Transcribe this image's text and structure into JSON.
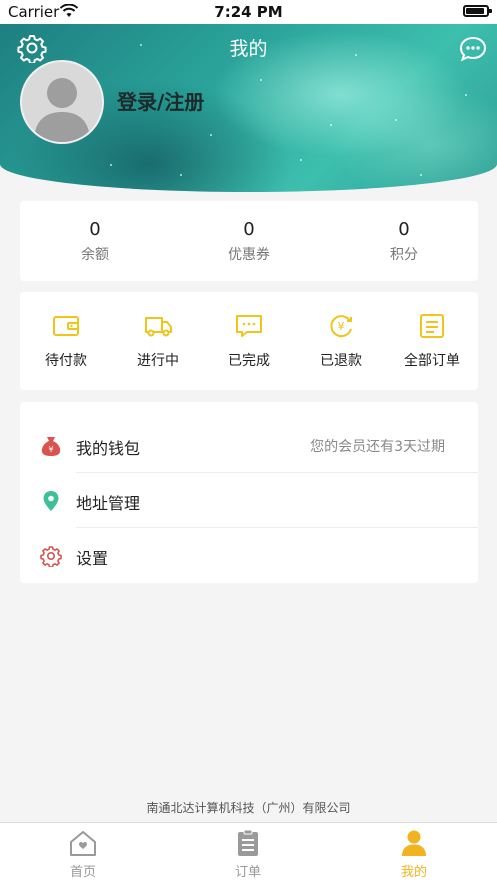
{
  "status_bar": {
    "carrier": "Carrier",
    "time": "7:24 PM"
  },
  "header": {
    "title": "我的",
    "login_label": "登录/注册"
  },
  "stats": [
    {
      "value": "0",
      "label": "余额"
    },
    {
      "value": "0",
      "label": "优惠券"
    },
    {
      "value": "0",
      "label": "积分"
    }
  ],
  "orders": [
    {
      "label": "待付款",
      "icon": "wallet-icon"
    },
    {
      "label": "进行中",
      "icon": "truck-icon"
    },
    {
      "label": "已完成",
      "icon": "chat-done-icon"
    },
    {
      "label": "已退款",
      "icon": "refund-icon"
    },
    {
      "label": "全部订单",
      "icon": "order-list-icon"
    }
  ],
  "menu": [
    {
      "label": "我的钱包",
      "note": "您的会员还有3天过期",
      "icon": "money-bag-icon"
    },
    {
      "label": "地址管理",
      "icon": "location-pin-icon"
    },
    {
      "label": "设置",
      "icon": "gear-icon"
    }
  ],
  "footer": {
    "company": "南通北达计算机科技（广州）有限公司"
  },
  "tabbar": {
    "items": [
      {
        "label": "首页",
        "icon": "home-icon"
      },
      {
        "label": "订单",
        "icon": "clipboard-icon"
      },
      {
        "label": "我的",
        "icon": "user-icon"
      }
    ],
    "active_index": 2
  },
  "colors": {
    "accent": "#f2b320",
    "icon_yellow": "#f0c419",
    "header_teal": "#2aa39a"
  }
}
